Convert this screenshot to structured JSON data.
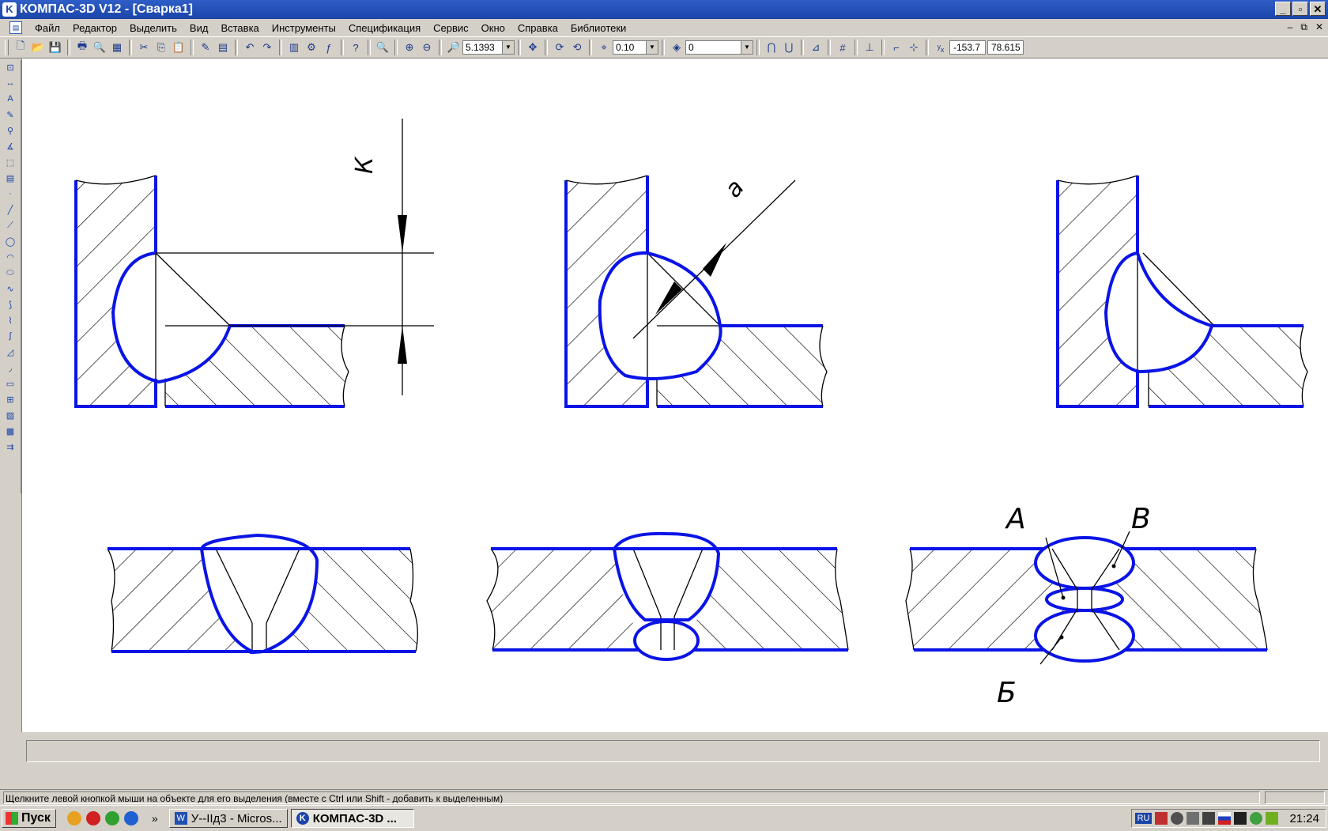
{
  "window": {
    "title": "КОМПАС-3D V12 - [Сварка1]",
    "buttons": [
      "_",
      "▫",
      "✕"
    ]
  },
  "menu": {
    "items": [
      "Файл",
      "Редактор",
      "Выделить",
      "Вид",
      "Вставка",
      "Инструменты",
      "Спецификация",
      "Сервис",
      "Окно",
      "Справка",
      "Библиотеки"
    ],
    "controls": [
      "–",
      "⧉",
      "✕"
    ]
  },
  "toolbar": {
    "zoom_value": "5.1393",
    "step_value": "0.10",
    "layer_value": "0",
    "coord_x": "-153.7",
    "coord_y": "78.615"
  },
  "drawing": {
    "label_k": "К",
    "label_a_top": "а",
    "label_A": "А",
    "label_B": "В",
    "label_Bb": "Б",
    "colors": {
      "outline": "#0a14e6",
      "hatch": "#000000"
    }
  },
  "status": {
    "message": "Щелкните левой кнопкой мыши на объекте для его выделения (вместе с Ctrl или Shift - добавить к выделенным)"
  },
  "taskbar": {
    "start": "Пуск",
    "more": "»",
    "tasks": [
      "У--IIд3 - Micros...",
      "КОМПАС-3D ..."
    ],
    "lang": "RU",
    "clock": "21:24"
  }
}
